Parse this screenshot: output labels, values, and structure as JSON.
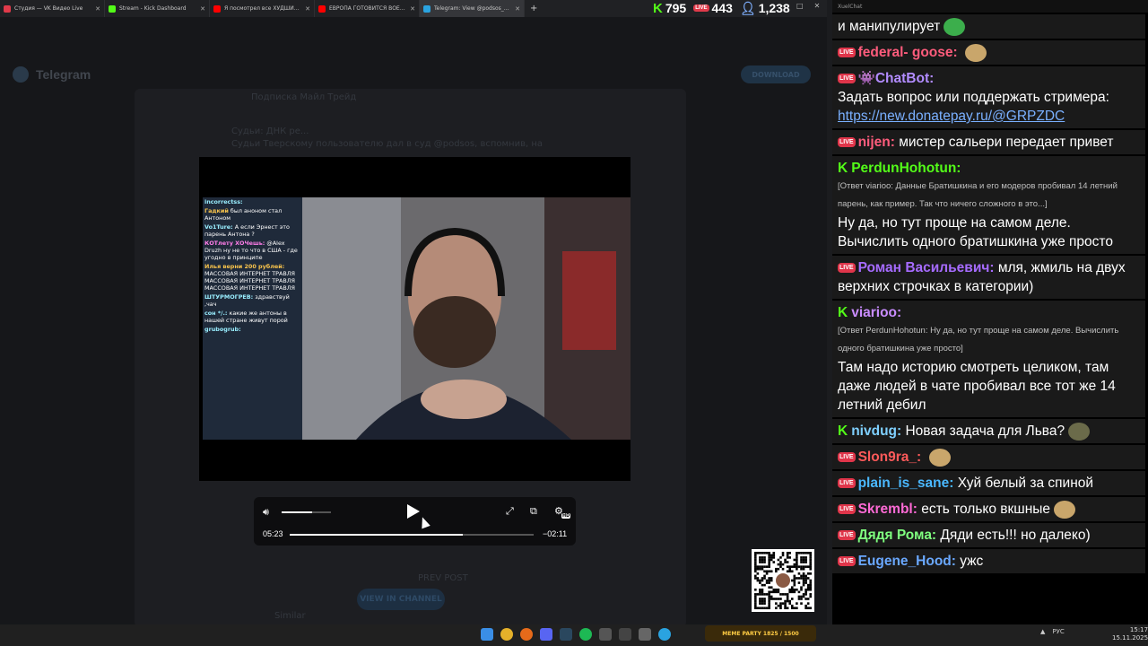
{
  "browser": {
    "tabs": [
      {
        "title": "Студия — VK Видео Live",
        "icon_color": "#e03a4a"
      },
      {
        "title": "Stream - Kick Dashboard",
        "icon_color": "#53fc18"
      },
      {
        "title": "Я посмотрел все ХУДШИЕ фи...",
        "icon_color": "#ff0000"
      },
      {
        "title": "ЕВРОПА ГОТОВИТСЯ ВОЕВАТЬ",
        "icon_color": "#ff0000"
      },
      {
        "title": "Telegram: View @podsos_club",
        "icon_color": "#2aa3e0"
      }
    ],
    "active_tab": 4,
    "new_tab": "+"
  },
  "stream_stats": {
    "kick_viewers": "795",
    "vk_viewers": "443",
    "total_viewers": "1,238",
    "colors": {
      "kick": "#53fc18",
      "vk": "#e03a4a",
      "total": "#7fb0ff"
    }
  },
  "telegram": {
    "brand": "Telegram",
    "download_label": "DOWNLOAD",
    "channel_title": "Подписка Майл Трейд",
    "faded_post": "Судьи: ДНК ре...",
    "faded_post_2": "Судьи Тверскому пользователю дал в суд @podsos, вспомнив, на",
    "view_in_channel": "VIEW IN CHANNEL",
    "similar": "Similar",
    "more": "PREV POST"
  },
  "inner_chat": [
    {
      "name": "incorrectss:",
      "text": "",
      "cls": ""
    },
    {
      "name": "Гадкий",
      "text": "был аноном стал Антоном",
      "cls": "o"
    },
    {
      "name": "Vo1Ture:",
      "text": "А если Эрнест это парень Антона ?",
      "cls": ""
    },
    {
      "name": "КОТлету ХОЧешь:",
      "text": "@Alex Druzh ну не то что в США - где угодно в принципе",
      "cls": "p"
    },
    {
      "name": "Илья верни 200 рублей:",
      "text": "МАССОВАЯ ИНТЕРНЕТ ТРАВЛЯ МАССОВАЯ ИНТЕРНЕТ ТРАВЛЯ МАССОВАЯ ИНТЕРНЕТ ТРАВЛЯ",
      "cls": "o"
    },
    {
      "name": "ШТУРМОГРЕВ:",
      "text": "здравствуй ,чач",
      "cls": ""
    },
    {
      "name": "сон */.:",
      "text": "какие же антоны в нашей стране живут порой",
      "cls": ""
    },
    {
      "name": "grubogrub:",
      "text": "",
      "cls": ""
    }
  ],
  "player": {
    "time_current": "05:23",
    "time_remaining": "−02:11",
    "progress": 0.71,
    "volume": 0.62,
    "quality_badge": "HD"
  },
  "overlay_chat": {
    "header": "XuelChat",
    "messages": [
      {
        "badge": "",
        "user": "",
        "user_color": "#ffffff",
        "text": "и манипулирует",
        "sub": "",
        "link": ""
      },
      {
        "badge": "live",
        "user": "federal- goose:",
        "user_color": "#ff5c7c",
        "text": "",
        "sub": "",
        "link": ""
      },
      {
        "badge": "live",
        "user": "👾ChatBot:",
        "user_color": "#b28cff",
        "text": "Задать вопрос или поддержать стримера:",
        "sub": "",
        "link": "https://new.donatepay.ru/@GRPZDC"
      },
      {
        "badge": "live",
        "user": "nijen:",
        "user_color": "#ff5c7c",
        "text": "мистер сальери передает привет",
        "sub": "",
        "link": ""
      },
      {
        "badge": "kick",
        "user": "PerdunHohotun:",
        "user_color": "#53fc18",
        "text": "Ну да, но тут проще на самом деле. Вычислить одного братишкина уже просто",
        "sub": "[Ответ viarioo: Данные Братишкина и его модеров пробивал 14 летний парень, как пример. Так что ничего сложного в это...]",
        "link": ""
      },
      {
        "badge": "live",
        "user": "Роман Васильевич:",
        "user_color": "#a66bff",
        "text": "мля, жмиль на двух верхних строчках в категории)",
        "sub": "",
        "link": ""
      },
      {
        "badge": "kick",
        "user": "viarioo:",
        "user_color": "#c98cff",
        "text": "Там надо историю смотреть целиком, там даже людей в чате пробивал все тот же 14 летний дебил",
        "sub": "[Ответ PerdunHohotun: Ну да, но тут проще на самом деле. Вычислить одного братишкина уже просто]",
        "link": ""
      },
      {
        "badge": "kick",
        "user": "nivdug:",
        "user_color": "#7fd0ff",
        "text": "Новая задача для Льва?",
        "sub": "",
        "link": ""
      },
      {
        "badge": "live",
        "user": "Slon9ra_:",
        "user_color": "#ff5a5a",
        "text": "",
        "sub": "",
        "link": ""
      },
      {
        "badge": "live",
        "user": "plain_is_sane:",
        "user_color": "#4ab8ff",
        "text": "Хуй белый за спиной",
        "sub": "",
        "link": ""
      },
      {
        "badge": "live",
        "user": "Skrembl:",
        "user_color": "#ff6ad5",
        "text": "есть только вкшные",
        "sub": "",
        "link": ""
      },
      {
        "badge": "live",
        "user": "Дядя Рома:",
        "user_color": "#7fff7f",
        "text": "Дяди есть!!! но далеко)",
        "sub": "",
        "link": ""
      },
      {
        "badge": "live",
        "user": "Eugene_Hood:",
        "user_color": "#6aa8ff",
        "text": "ужс",
        "sub": "",
        "link": ""
      }
    ]
  },
  "taskbar": {
    "meme_label": "MEME PARTY",
    "meme_count": "1825 / 1500",
    "lang": "РУС",
    "time": "15:17",
    "date": "15.11.2025"
  }
}
